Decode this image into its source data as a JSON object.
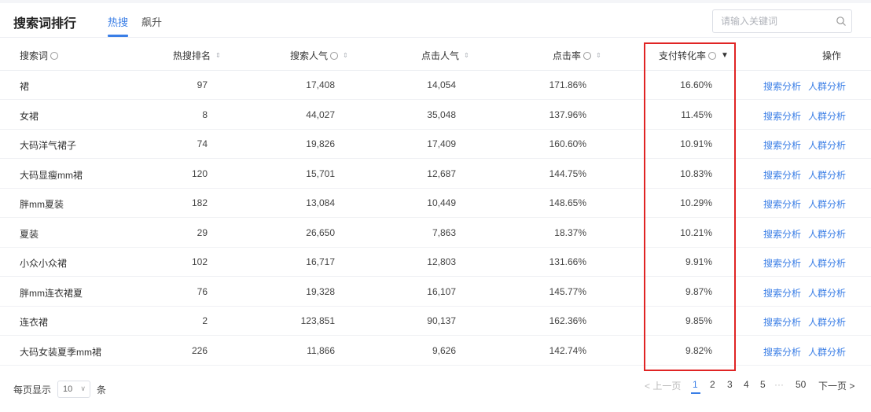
{
  "header": {
    "title": "搜索词排行",
    "tabs": [
      {
        "label": "热搜",
        "active": true
      },
      {
        "label": "飙升",
        "active": false
      }
    ],
    "search_placeholder": "请输入关键词"
  },
  "table": {
    "columns": [
      {
        "label": "搜索词",
        "info": true
      },
      {
        "label": "热搜排名",
        "sortable": true
      },
      {
        "label": "搜索人气",
        "info": true,
        "sortable": true
      },
      {
        "label": "点击人气",
        "sortable": true
      },
      {
        "label": "点击率",
        "info": true,
        "sortable": true
      },
      {
        "label": "支付转化率",
        "info": true,
        "sortable": true,
        "sorted": "desc"
      },
      {
        "label": "操作"
      }
    ],
    "rows": [
      {
        "term": "裙",
        "rank": "97",
        "search": "17,408",
        "click": "14,054",
        "ctr": "171.86%",
        "cvr": "16.60%"
      },
      {
        "term": "女裙",
        "rank": "8",
        "search": "44,027",
        "click": "35,048",
        "ctr": "137.96%",
        "cvr": "11.45%"
      },
      {
        "term": "大码洋气裙子",
        "rank": "74",
        "search": "19,826",
        "click": "17,409",
        "ctr": "160.60%",
        "cvr": "10.91%"
      },
      {
        "term": "大码显瘦mm裙",
        "rank": "120",
        "search": "15,701",
        "click": "12,687",
        "ctr": "144.75%",
        "cvr": "10.83%"
      },
      {
        "term": "胖mm夏装",
        "rank": "182",
        "search": "13,084",
        "click": "10,449",
        "ctr": "148.65%",
        "cvr": "10.29%"
      },
      {
        "term": "夏装",
        "rank": "29",
        "search": "26,650",
        "click": "7,863",
        "ctr": "18.37%",
        "cvr": "10.21%"
      },
      {
        "term": "小众小众裙",
        "rank": "102",
        "search": "16,717",
        "click": "12,803",
        "ctr": "131.66%",
        "cvr": "9.91%"
      },
      {
        "term": "胖mm连衣裙夏",
        "rank": "76",
        "search": "19,328",
        "click": "16,107",
        "ctr": "145.77%",
        "cvr": "9.87%"
      },
      {
        "term": "连衣裙",
        "rank": "2",
        "search": "123,851",
        "click": "90,137",
        "ctr": "162.36%",
        "cvr": "9.85%"
      },
      {
        "term": "大码女装夏季mm裙",
        "rank": "226",
        "search": "11,866",
        "click": "9,626",
        "ctr": "142.74%",
        "cvr": "9.82%"
      }
    ],
    "actions": [
      "搜索分析",
      "人群分析"
    ]
  },
  "footer": {
    "page_size_prefix": "每页显示",
    "page_size_value": "10",
    "page_size_suffix": "条",
    "prev": "< 上一页",
    "pages": [
      "1",
      "2",
      "3",
      "4",
      "5",
      "···",
      "50"
    ],
    "current_page": "1",
    "next": "下一页 >"
  },
  "colors": {
    "accent": "#3a7ee6",
    "highlight": "#e02424"
  }
}
